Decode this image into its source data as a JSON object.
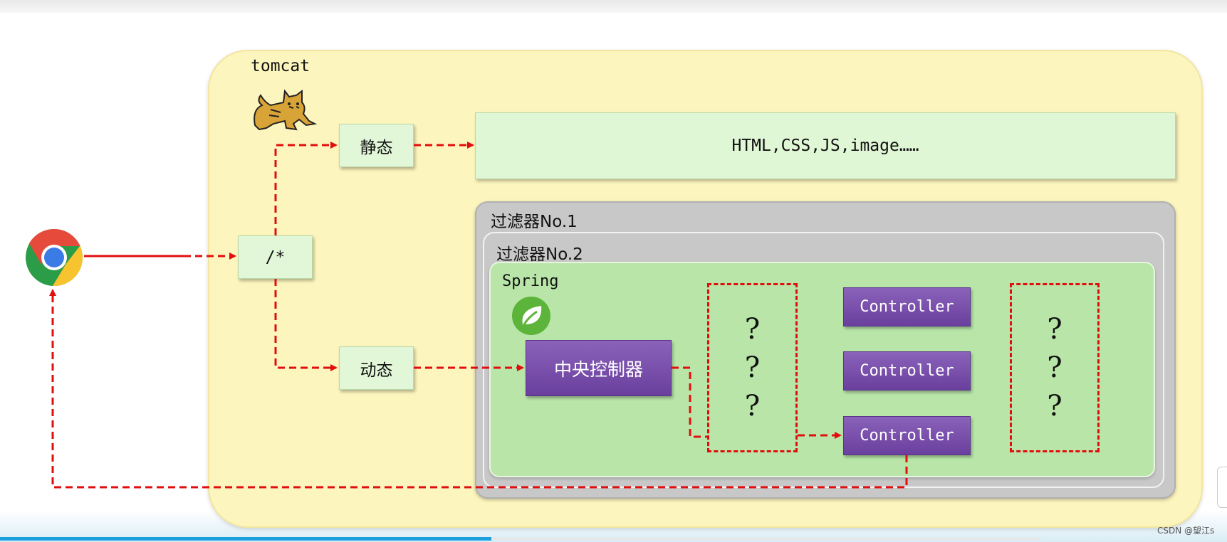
{
  "tomcat": {
    "title": "tomcat",
    "logo": "tomcat-cat-logo"
  },
  "browser": {
    "icon": "chrome-icon"
  },
  "nodes": {
    "root": "/*",
    "static": "静态",
    "dynamic": "动态",
    "static_resources": "HTML,CSS,JS,image……"
  },
  "filters": {
    "first": "过滤器No.1",
    "second": "过滤器No.2"
  },
  "spring": {
    "title": "Spring",
    "logo": "spring-leaf-icon",
    "central_controller": "中央控制器",
    "controllers": [
      "Controller",
      "Controller",
      "Controller"
    ],
    "unknown_left": [
      "?",
      "?",
      "?"
    ],
    "unknown_right": [
      "?",
      "?",
      "?"
    ]
  },
  "watermark": "CSDN @望江s",
  "colors": {
    "arrow": "#e10e0e",
    "tomcat_bg": "#fcf5bd",
    "node_bg": "#e2f7d8",
    "spring_bg": "#b9e6a8",
    "controller": "#7b4fae",
    "filter_bg": "#c8c8c8"
  }
}
